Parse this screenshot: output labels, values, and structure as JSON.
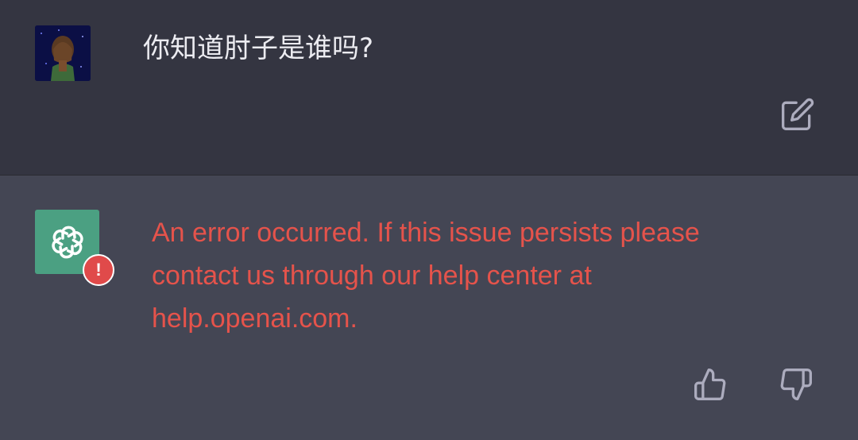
{
  "user_message": {
    "avatar": "user-avatar-image",
    "text": "你知道肘子是谁吗?",
    "edit_icon": "edit-icon"
  },
  "assistant_message": {
    "avatar": "openai-logo-icon",
    "badge_icon": "error-badge-icon",
    "badge_text": "!",
    "error_text": "An error occurred. If this issue persists please contact us through our help center at help.openai.com.",
    "thumbs_up_icon": "thumbs-up-icon",
    "thumbs_down_icon": "thumbs-down-icon"
  },
  "colors": {
    "user_bg": "#343541",
    "assistant_bg": "#444654",
    "error_text": "#e5534b",
    "logo_bg": "#4ba082",
    "icon_gray": "#acacbe"
  }
}
